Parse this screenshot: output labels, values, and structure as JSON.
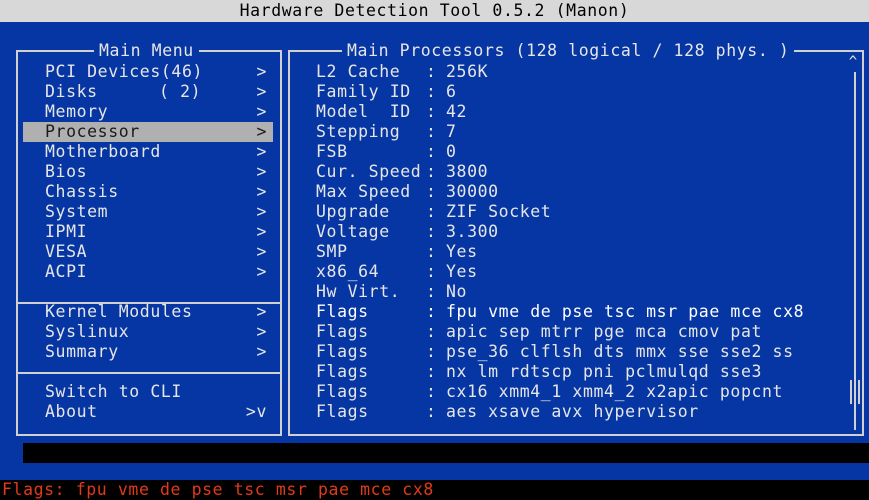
{
  "window": {
    "title": "Hardware Detection Tool 0.5.2 (Manon)"
  },
  "menu": {
    "title": "Main Menu",
    "items": [
      {
        "label": "PCI Devices(46)",
        "count": "",
        "arrow": ">"
      },
      {
        "label": "Disks",
        "count": "( 2)",
        "arrow": ">"
      },
      {
        "label": "Memory",
        "count": "",
        "arrow": ">"
      },
      {
        "label": "Processor",
        "count": "",
        "arrow": ">"
      },
      {
        "label": "Motherboard",
        "count": "",
        "arrow": ">"
      },
      {
        "label": "Bios",
        "count": "",
        "arrow": ">"
      },
      {
        "label": "Chassis",
        "count": "",
        "arrow": ">"
      },
      {
        "label": "System",
        "count": "",
        "arrow": ">"
      },
      {
        "label": "IPMI",
        "count": "",
        "arrow": ">"
      },
      {
        "label": "VESA",
        "count": "",
        "arrow": ">"
      },
      {
        "label": "ACPI",
        "count": "",
        "arrow": ">"
      },
      {
        "label": "Kernel Modules",
        "count": "",
        "arrow": ">"
      },
      {
        "label": "Syslinux",
        "count": "",
        "arrow": ">"
      },
      {
        "label": "Summary",
        "count": "",
        "arrow": ">"
      },
      {
        "label": "Switch to CLI",
        "count": "",
        "arrow": ""
      },
      {
        "label": "About",
        "count": "",
        "arrow": ">v"
      }
    ]
  },
  "processor": {
    "title": "Main Processors (128 logical / 128 phys. )",
    "rows": [
      {
        "key": "L2 Cache",
        "sep": ":",
        "value": "256K"
      },
      {
        "key": "Family ID",
        "sep": ":",
        "value": "6"
      },
      {
        "key": "Model  ID",
        "sep": ":",
        "value": "42"
      },
      {
        "key": "Stepping",
        "sep": ":",
        "value": "7"
      },
      {
        "key": "FSB",
        "sep": ":",
        "value": "0"
      },
      {
        "key": "Cur. Speed",
        "sep": ":",
        "value": "3800"
      },
      {
        "key": "Max Speed",
        "sep": ":",
        "value": "30000"
      },
      {
        "key": "Upgrade",
        "sep": ":",
        "value": "ZIF Socket"
      },
      {
        "key": "Voltage",
        "sep": ":",
        "value": "3.300"
      },
      {
        "key": "SMP",
        "sep": ":",
        "value": "Yes"
      },
      {
        "key": "x86_64",
        "sep": ":",
        "value": "Yes"
      },
      {
        "key": "Hw Virt.",
        "sep": ":",
        "value": "No"
      },
      {
        "key": "Flags",
        "sep": ":",
        "value": "fpu vme de pse tsc msr pae mce cx8"
      },
      {
        "key": "Flags",
        "sep": ":",
        "value": "apic sep mtrr pge mca cmov pat"
      },
      {
        "key": "Flags",
        "sep": ":",
        "value": "pse_36 clflsh dts mmx sse sse2 ss"
      },
      {
        "key": "Flags",
        "sep": ":",
        "value": "nx lm rdtscp pni pclmulqd sse3"
      },
      {
        "key": "Flags",
        "sep": ":",
        "value": "cx16 xmm4_1 xmm4_2 x2apic popcnt"
      },
      {
        "key": "Flags",
        "sep": ":",
        "value": "aes xsave avx hypervisor"
      }
    ],
    "scroll_up_glyph": "^"
  },
  "status": {
    "text": "Flags: fpu vme de pse tsc msr pae mce cx8"
  },
  "colors": {
    "background": "#0636a4",
    "title_bar": "#d8d8d8",
    "selected": "#b0b0b0",
    "status_text": "#e03a1a"
  }
}
